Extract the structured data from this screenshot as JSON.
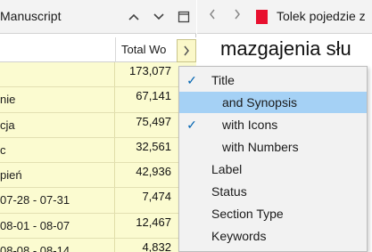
{
  "outline": {
    "title": "Manuscript",
    "column_header": "Total Wo",
    "rows": [
      {
        "name": "",
        "value": "173,077"
      },
      {
        "name": "nie",
        "value": "67,141"
      },
      {
        "name": "cja",
        "value": "75,497"
      },
      {
        "name": "c",
        "value": "32,561"
      },
      {
        "name": "pień",
        "value": "42,936"
      },
      {
        "name": " 07-28 - 07-31",
        "value": "7,474"
      },
      {
        "name": " 08-01 - 08-07",
        "value": "12,467"
      },
      {
        "name": " 08-08 - 08-14",
        "value": "4,832"
      }
    ],
    "colors": {
      "row_bg": "#fbfbd0"
    }
  },
  "editor": {
    "doc_title": "Tolek pojedzie z",
    "heading": "mazgajenia słu",
    "doc_icon_color": "#e8102f"
  },
  "menu": {
    "items": [
      {
        "label": "Title",
        "checked": true,
        "indent": false,
        "highlighted": false
      },
      {
        "label": "and Synopsis",
        "checked": false,
        "indent": true,
        "highlighted": true
      },
      {
        "label": "with Icons",
        "checked": true,
        "indent": true,
        "highlighted": false
      },
      {
        "label": "with Numbers",
        "checked": false,
        "indent": true,
        "highlighted": false
      },
      {
        "label": "Label",
        "checked": false,
        "indent": false,
        "highlighted": false
      },
      {
        "label": "Status",
        "checked": false,
        "indent": false,
        "highlighted": false
      },
      {
        "label": "Section Type",
        "checked": false,
        "indent": false,
        "highlighted": false
      },
      {
        "label": "Keywords",
        "checked": false,
        "indent": false,
        "highlighted": false
      }
    ],
    "check_glyph": "✓",
    "highlight_color": "#a5d1f5"
  },
  "icons": {
    "collapse_up": "chevron-up-icon",
    "collapse_down": "chevron-down-icon",
    "window": "window-icon",
    "nav_back": "chevron-left-icon",
    "nav_forward": "chevron-right-icon",
    "doc": "document-icon",
    "column_expand": "chevron-right-icon"
  }
}
